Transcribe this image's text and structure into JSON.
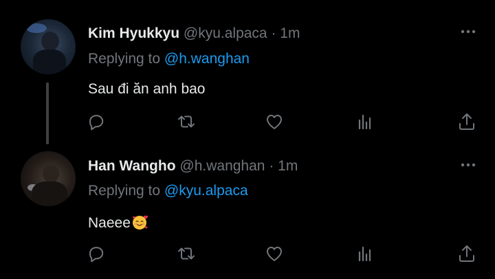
{
  "tweets": [
    {
      "name": "Kim Hyukkyu",
      "handle": "@kyu.alpaca",
      "separator": "·",
      "time": "1m",
      "replying_label": "Replying to",
      "replying_to": "@h.wanghan",
      "text": "Sau đi ăn anh bao",
      "emoji": ""
    },
    {
      "name": "Han Wangho",
      "handle": "@h.wanghan",
      "separator": "·",
      "time": "1m",
      "replying_label": "Replying to",
      "replying_to": "@kyu.alpaca",
      "text": "Naeee",
      "emoji": "smiling-face-with-hearts"
    }
  ],
  "icons": {
    "reply": "reply-icon",
    "retweet": "retweet-icon",
    "like": "heart-icon",
    "stats": "views-icon",
    "share": "share-icon",
    "more": "more-icon"
  },
  "colors": {
    "background": "#000000",
    "text": "#e7e9ea",
    "secondary": "#71767b",
    "accent": "#1d9bf0",
    "thread_line": "#3e4144"
  }
}
